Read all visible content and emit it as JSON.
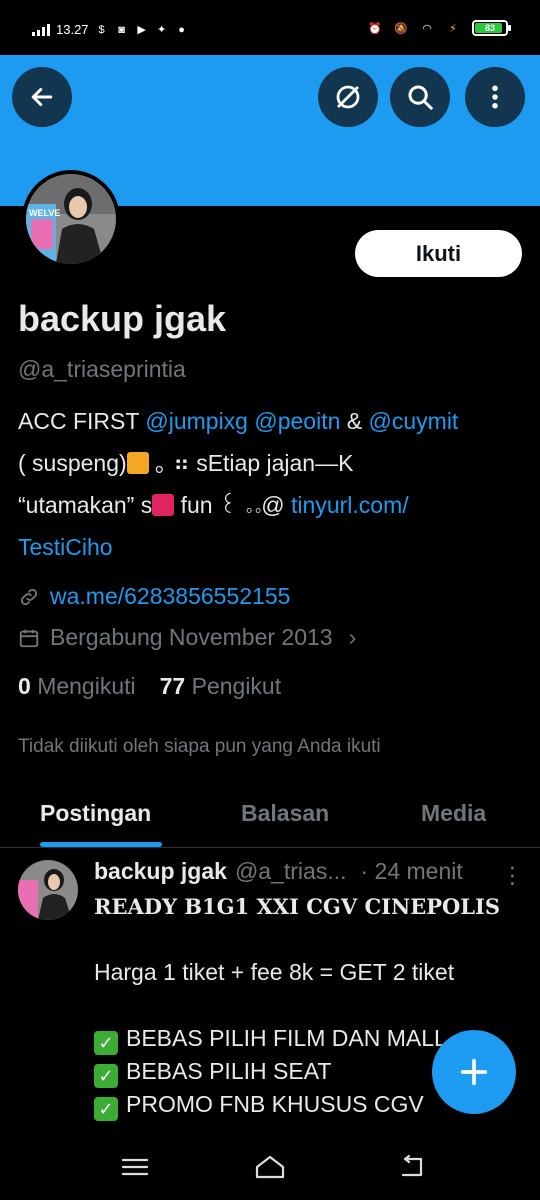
{
  "status_bar": {
    "time": "13.27",
    "battery": "83"
  },
  "profile": {
    "name": "backup jgak",
    "handle": "@a_triaseprintia",
    "follow_label": "Ikuti",
    "avatar_text": "WELVE",
    "bio": {
      "l1_text": "ACC FIRST ",
      "l1_link1": "@jumpixg",
      "l1_link2": "@peoitn",
      "l1_amp": " & ",
      "l1_link3": "@cuymit",
      "l2_a": "( suspeng)",
      "l2_b": " ｡ ⠶ sEtiap jajan—K",
      "l3_a": "“utamakan” s",
      "l3_b": " fun  ꒰ ｡｡@ ",
      "l3_link": "tinyurl.com/",
      "l4_link": "TestiCiho"
    },
    "website": "wa.me/6283856552155",
    "joined": "Bergabung November 2013",
    "following_count": "0",
    "following_label": "Mengikuti",
    "followers_count": "77",
    "followers_label": "Pengikut",
    "not_followed_text": "Tidak diikuti oleh siapa pun yang Anda ikuti"
  },
  "tabs": [
    {
      "label": "Postingan"
    },
    {
      "label": "Balasan"
    },
    {
      "label": "Media"
    }
  ],
  "post": {
    "name": "backup jgak",
    "handle": "@a_trias...",
    "time": "· 24 menit",
    "line1": "READY B1G1 XXI CGV CINEPOLIS",
    "line2": "Harga 1 tiket + fee 8k = GET 2 tiket",
    "line3": "BEBAS PILIH FILM DAN MALL",
    "line4": "BEBAS PILIH SEAT",
    "line5": "PROMO FNB KHUSUS CGV"
  },
  "colors": {
    "accent": "#1d9bf0",
    "background": "#000000",
    "text": "#e7e9ea",
    "muted": "#71767b"
  },
  "icons": {
    "back": "arrow-left-icon",
    "block": "no-grok-icon",
    "search": "search-icon",
    "more": "more-vertical-icon",
    "link": "link-icon",
    "calendar": "calendar-icon",
    "compose": "plus-icon"
  }
}
